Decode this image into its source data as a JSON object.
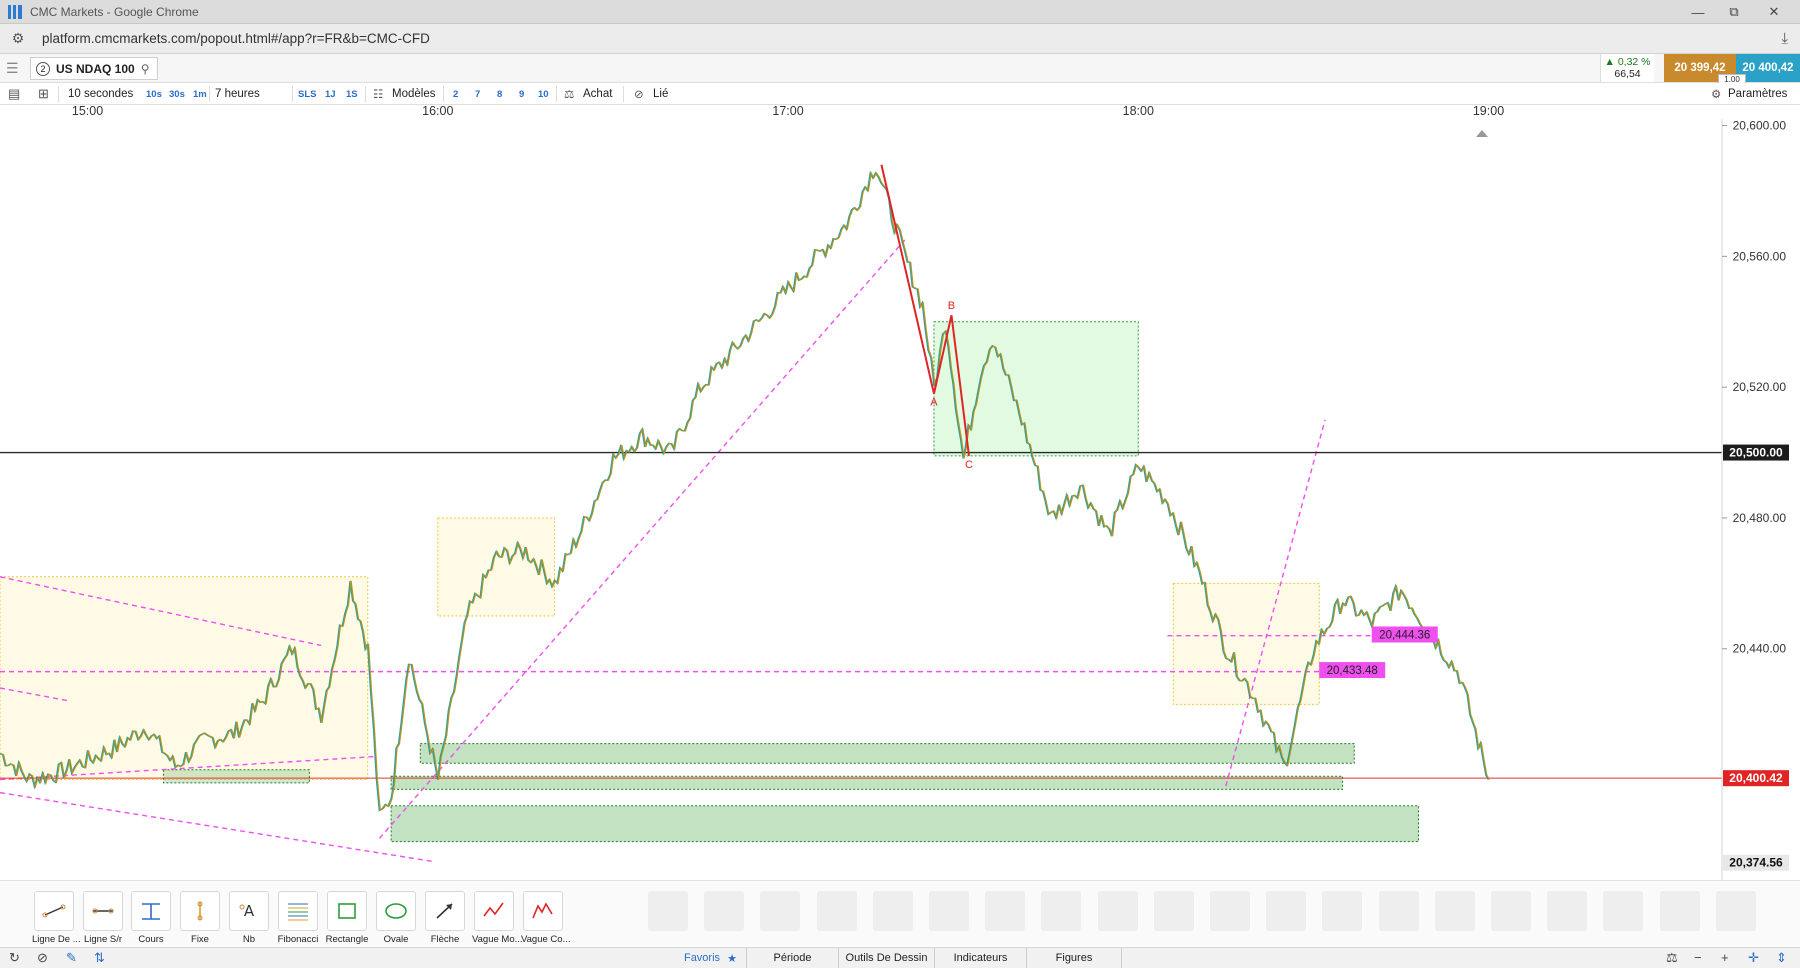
{
  "window": {
    "title": "CMC Markets - Google Chrome",
    "minimize": "—",
    "restore": "⧉",
    "close": "✕"
  },
  "address": {
    "url": "platform.cmcmarkets.com/popout.html#/app?r=FR&b=CMC-CFD"
  },
  "instrument": {
    "number": "2",
    "name": "US NDAQ 100"
  },
  "quote": {
    "change_pct": "0,32 %",
    "change_pts": "66,54",
    "sell": "20 399,42",
    "buy": "20 400,42",
    "spread": "1.00",
    "up_color": "#1a7a1a",
    "sell_color": "#c98a2e",
    "buy_color": "#2aa1c6"
  },
  "toolbar": {
    "interval": "10 secondes",
    "intervals": [
      "10s",
      "30s",
      "1m"
    ],
    "span": "7 heures",
    "ranges": [
      "SLS",
      "1J",
      "1S"
    ],
    "models": "Modèles",
    "numbers": [
      "2",
      "7",
      "8",
      "9",
      "10"
    ],
    "buy": "Achat",
    "linked": "Lié",
    "settings": "Paramètres"
  },
  "chart_data": {
    "type": "line",
    "instrument": "US NDAQ 100",
    "x_ticks": [
      "15:00",
      "16:00",
      "17:00",
      "18:00",
      "19:00"
    ],
    "y_ticks": [
      "20,600.00",
      "20,560.00",
      "20,520.00",
      "20,480.00",
      "20,440.00"
    ],
    "y_tick_values": [
      20600,
      20560,
      20520,
      20480,
      20440
    ],
    "ylim": [
      20365,
      20602
    ],
    "xlim": [
      "14:45",
      "19:40"
    ],
    "series": [
      {
        "x": [
          "14:45",
          "14:50",
          "14:55",
          "15:00",
          "15:05",
          "15:10",
          "15:15",
          "15:20",
          "15:25",
          "15:30",
          "15:35",
          "15:40",
          "15:45",
          "15:48",
          "15:50",
          "15:52",
          "15:55",
          "16:00",
          "16:05",
          "16:10",
          "16:15",
          "16:20",
          "16:25",
          "16:30",
          "16:35",
          "16:40",
          "16:45",
          "16:50",
          "16:55",
          "17:00",
          "17:05",
          "17:10",
          "17:15",
          "17:20",
          "17:23",
          "17:25",
          "17:27",
          "17:30",
          "17:33",
          "17:35",
          "17:40",
          "17:45",
          "17:50",
          "17:55",
          "18:00",
          "18:05",
          "18:10",
          "18:15",
          "18:20",
          "18:25",
          "18:30",
          "18:35",
          "18:40",
          "18:45",
          "18:50",
          "18:55",
          "19:00"
        ],
        "values": [
          20408,
          20400,
          20402,
          20406,
          20410,
          20416,
          20404,
          20412,
          20414,
          20424,
          20440,
          20420,
          20460,
          20440,
          20388,
          20395,
          20438,
          20400,
          20450,
          20468,
          20470,
          20460,
          20478,
          20498,
          20505,
          20500,
          20520,
          20530,
          20540,
          20550,
          20560,
          20570,
          20588,
          20560,
          20545,
          20520,
          20540,
          20498,
          20525,
          20535,
          20510,
          20480,
          20490,
          20475,
          20496,
          20485,
          20465,
          20440,
          20425,
          20404,
          20440,
          20455,
          20448,
          20458,
          20445,
          20432,
          20400
        ]
      }
    ],
    "levels": {
      "horizontal_line": "20,500.00",
      "current_price": "20,400.42",
      "lower_marker": "20,374.56",
      "magenta_upper": "20,444.36",
      "magenta_lower": "20,433.48"
    },
    "abc_labels": [
      "A",
      "B",
      "C"
    ],
    "colors": {
      "price": "#c8920f",
      "teal": "#14908a",
      "pattern": "#e02424",
      "trend": "#ee4fee",
      "zone": "#2e9e3a",
      "box": "#e8c93e"
    }
  },
  "tools": [
    {
      "label": "Ligne De ...",
      "icon": "line-icon"
    },
    {
      "label": "Ligne S/r",
      "icon": "sr-line-icon"
    },
    {
      "label": "Cours",
      "icon": "price-icon"
    },
    {
      "label": "Fixe",
      "icon": "fixed-icon"
    },
    {
      "label": "Nb",
      "icon": "note-icon"
    },
    {
      "label": "Fibonacci",
      "icon": "fibonacci-icon"
    },
    {
      "label": "Rectangle",
      "icon": "rectangle-icon"
    },
    {
      "label": "Ovale",
      "icon": "oval-icon"
    },
    {
      "label": "Flèche",
      "icon": "arrow-icon"
    },
    {
      "label": "Vague Mo...",
      "icon": "wave-icon"
    },
    {
      "label": "Vague Co...",
      "icon": "wave-corr-icon"
    }
  ],
  "bottom_tabs": [
    "Favoris",
    "Période",
    "Outils De Dessin",
    "Indicateurs",
    "Figures"
  ],
  "star": "★"
}
